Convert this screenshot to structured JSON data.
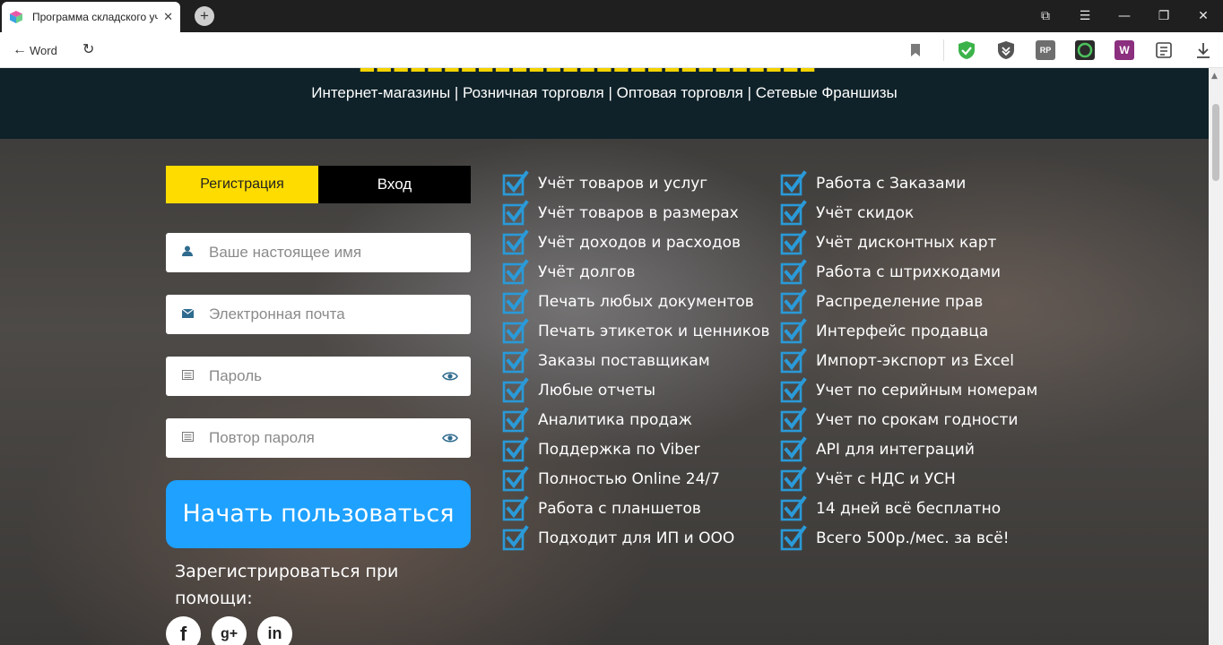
{
  "browser": {
    "tab_title": "Программа складского учёта",
    "tab_close": "✕",
    "new_tab": "+",
    "back_label": "Word",
    "controls": [
      "⧉",
      "☰",
      "—",
      "❐",
      "✕"
    ]
  },
  "header": {
    "tagline": "Интернет-магазины | Розничная торговля | Оптовая торговля | Сетевые Франшизы"
  },
  "auth": {
    "tab_register": "Регистрация",
    "tab_login": "Вход",
    "name_placeholder": "Ваше настоящее имя",
    "email_placeholder": "Электронная почта",
    "password_placeholder": "Пароль",
    "password_repeat_placeholder": "Повтор пароля",
    "submit_label": "Начать пользоваться",
    "social_text": "Зарегистрироваться при помощи:",
    "social": [
      "f",
      "g+",
      "in"
    ]
  },
  "features_left": [
    "Учёт товаров и услуг",
    "Учёт товаров в размерах",
    "Учёт доходов и расходов",
    "Учёт долгов",
    "Печать любых документов",
    "Печать этикеток и ценников",
    "Заказы поставщикам",
    "Любые отчеты",
    "Аналитика продаж",
    "Поддержка по Viber",
    "Полностью Online 24/7",
    "Работа с планшетов",
    "Подходит для ИП и ООО"
  ],
  "features_right": [
    "Работа с Заказами",
    "Учёт скидок",
    "Учёт дисконтных карт",
    "Работа с штрихкодами",
    "Распределение прав",
    "Интерфейс продавца",
    "Импорт-экспорт из Excel",
    "Учет по серийным номерам",
    "Учет по срокам годности",
    "API для интеграций",
    "Учёт с НДС и УСН",
    "14 дней всё бесплатно",
    "Всего 500р./мес. за всё!"
  ],
  "colors": {
    "accent_yellow": "#ffdc00",
    "cta_blue": "#1ea1ff",
    "check_blue": "#2a9ad8",
    "header_dark": "#0f2229"
  }
}
